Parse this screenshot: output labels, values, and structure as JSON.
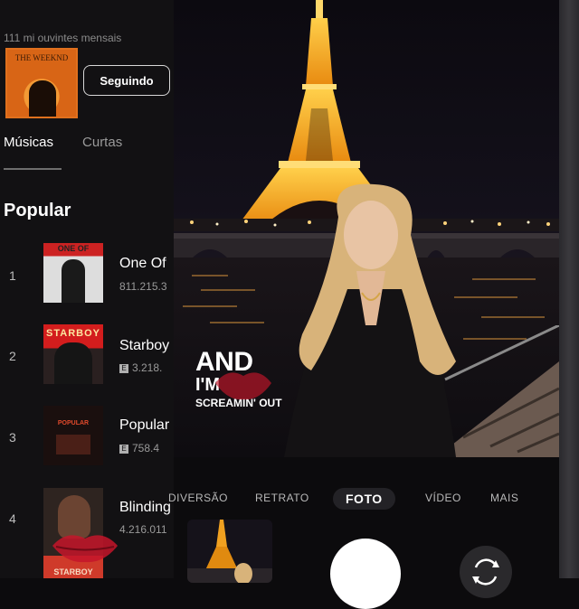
{
  "artist": {
    "listeners": "111 mi ouvintes mensais",
    "album_cover_title": "THE WEEKND",
    "follow_label": "Seguindo"
  },
  "tabs": [
    {
      "label": "Músicas",
      "active": true
    },
    {
      "label": "Curtas",
      "active": false
    }
  ],
  "section_title": "Popular",
  "tracks": [
    {
      "num": "1",
      "title": "One Of",
      "plays": "811.215.3",
      "cover_text": "ONE OF",
      "explicit": false
    },
    {
      "num": "2",
      "title": "Starboy",
      "plays": "3.218.",
      "cover_text": "STARBOY",
      "explicit": true
    },
    {
      "num": "3",
      "title": "Popular",
      "plays": "758.4",
      "cover_text": "POPULAR",
      "explicit": true
    },
    {
      "num": "4",
      "title": "Blinding",
      "plays": "4.216.011",
      "cover_text": "STARBOY",
      "explicit": false
    }
  ],
  "lyrics": {
    "line1": "AND",
    "line2": "I'M",
    "line3": "SCREAMIN' OUT"
  },
  "camera_modes": [
    {
      "label": "DIVERSÃO",
      "active": false
    },
    {
      "label": "RETRATO",
      "active": false
    },
    {
      "label": "FOTO",
      "active": true
    },
    {
      "label": "VÍDEO",
      "active": false
    },
    {
      "label": "MAIS",
      "active": false
    }
  ],
  "colors": {
    "accent_orange": "#e0701d",
    "tower_gold": "#f0a020",
    "background": "#0c0b0d"
  }
}
